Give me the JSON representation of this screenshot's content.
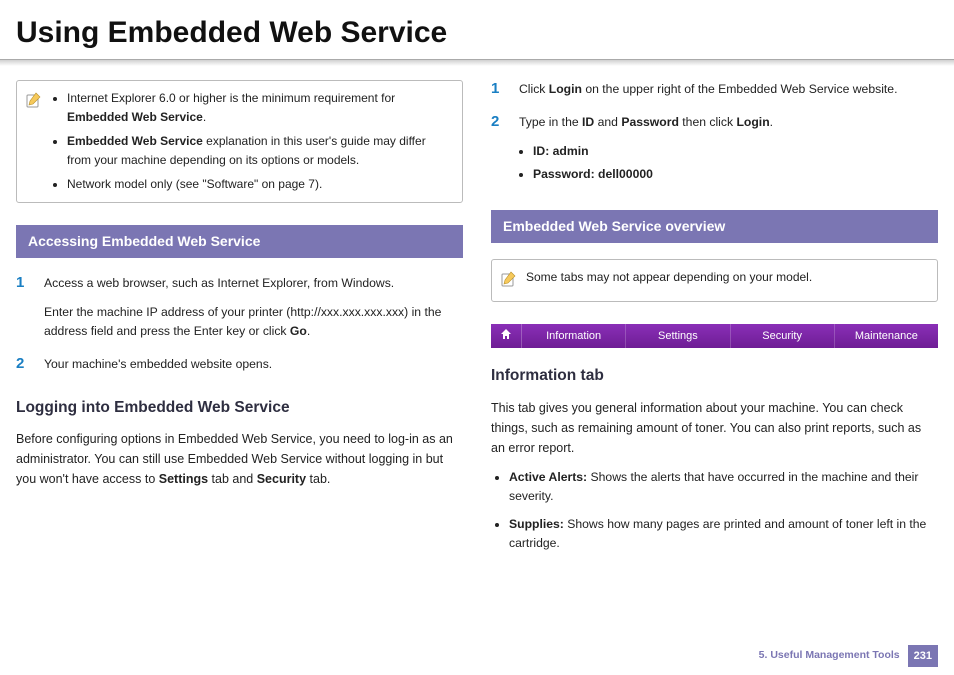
{
  "page_title": "Using Embedded Web Service",
  "left": {
    "note_items": [
      "Internet Explorer 6.0 or higher is the minimum requirement for <b>Embedded Web Service</b>.",
      "<b>Embedded Web Service</b> explanation in this user's guide may differ from your machine depending on its options or models.",
      "Network model only (see \"Software\" on page 7)."
    ],
    "section_head": "Accessing Embedded Web Service",
    "steps": [
      {
        "num": "1",
        "paras": [
          "Access a web browser, such as Internet Explorer, from Windows.",
          "Enter the machine IP address of your printer (http://xxx.xxx.xxx.xxx) in the address field and press the Enter key or click <b>Go</b>."
        ]
      },
      {
        "num": "2",
        "paras": [
          "Your machine's embedded website opens."
        ]
      }
    ],
    "h3": "Logging into Embedded Web Service",
    "para": "Before configuring options in Embedded Web Service, you need to log-in as an administrator. You can still use Embedded Web Service without logging in but you won't have access to <b>Settings</b> tab and <b>Security</b> tab."
  },
  "right": {
    "steps": [
      {
        "num": "1",
        "paras": [
          "Click <b>Login</b> on the upper right of the Embedded Web Service website."
        ]
      },
      {
        "num": "2",
        "paras": [
          "Type in the <b>ID</b> and <b>Password</b> then click <b>Login</b>."
        ],
        "bullets": [
          "<b>ID: admin</b>",
          "<b>Password: dell00000</b>"
        ]
      }
    ],
    "section_head": "Embedded Web Service overview",
    "note_text": "Some tabs may not appear depending on your model.",
    "tabs": [
      "Information",
      "Settings",
      "Security",
      "Maintenance"
    ],
    "h3": "Information tab",
    "para": "This tab gives you general information about your machine. You can check things, such as remaining amount of toner. You can also print reports, such as an error report.",
    "bullets": [
      "<b>Active Alerts:</b> Shows the alerts that have occurred in the machine and their severity.",
      "<b>Supplies:</b> Shows how many pages are printed and amount of toner left in the cartridge."
    ]
  },
  "footer": {
    "chapter": "5.  Useful Management Tools",
    "page": "231"
  }
}
